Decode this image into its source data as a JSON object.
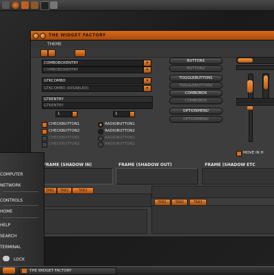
{
  "window": {
    "title": "THE WIDGET FACTORY"
  },
  "menu": {
    "theme": "THEME"
  },
  "entries": {
    "combo_entry": "COMBOBOXENTRY",
    "combo_entry_disabled": "COMBOBOXENTRY",
    "gtk_combo": "GTKCOMBO",
    "gtk_combo_disabled": "GTKCOMBO (DISABLED)",
    "gtk_entry": "GTKENTRY",
    "gtk_entry_disabled": "GTKENTRY",
    "spin1": "1",
    "spin2": "1"
  },
  "checks": {
    "check1": "CHECKBUTTON1",
    "check2": "CHECKBUTTON2",
    "radio1": "RADIOBUTTON1",
    "radio2": "RADIOBUTTON2"
  },
  "buttons": {
    "button1": "BUTTON1",
    "button2": "BUTTON2",
    "toggle1": "TOGGLEBUTTON1",
    "toggle2": "TOGGLEBUTTON2",
    "combobox": "COMBOBOX",
    "combobox2": "COMBOBOX",
    "optionmenu": "OPTIONMENU",
    "optionmenu2": "OPTIONMENU"
  },
  "move_label": "MOVE IN H",
  "frames": {
    "frame_in": "FRAME (SHADOW IN)",
    "frame_out": "FRAME (SHADOW OUT)",
    "frame_etched": "FRAME (SHADOW ETC"
  },
  "tabs": [
    "TAB1",
    "TAB2",
    "TAB3"
  ],
  "sidemenu": {
    "computer": "COMPUTER",
    "network": "NETWORK",
    "controls": "CONTROLS",
    "home": "HOME",
    "help": "HELP",
    "search": "SEARCH",
    "terminal": "TERMINAL",
    "lock": "LOCK"
  },
  "taskbar": {
    "item": "THE WIDGET FACTORY"
  },
  "colors": {
    "accent": "#e06a15",
    "bg": "#3d3d3d"
  }
}
